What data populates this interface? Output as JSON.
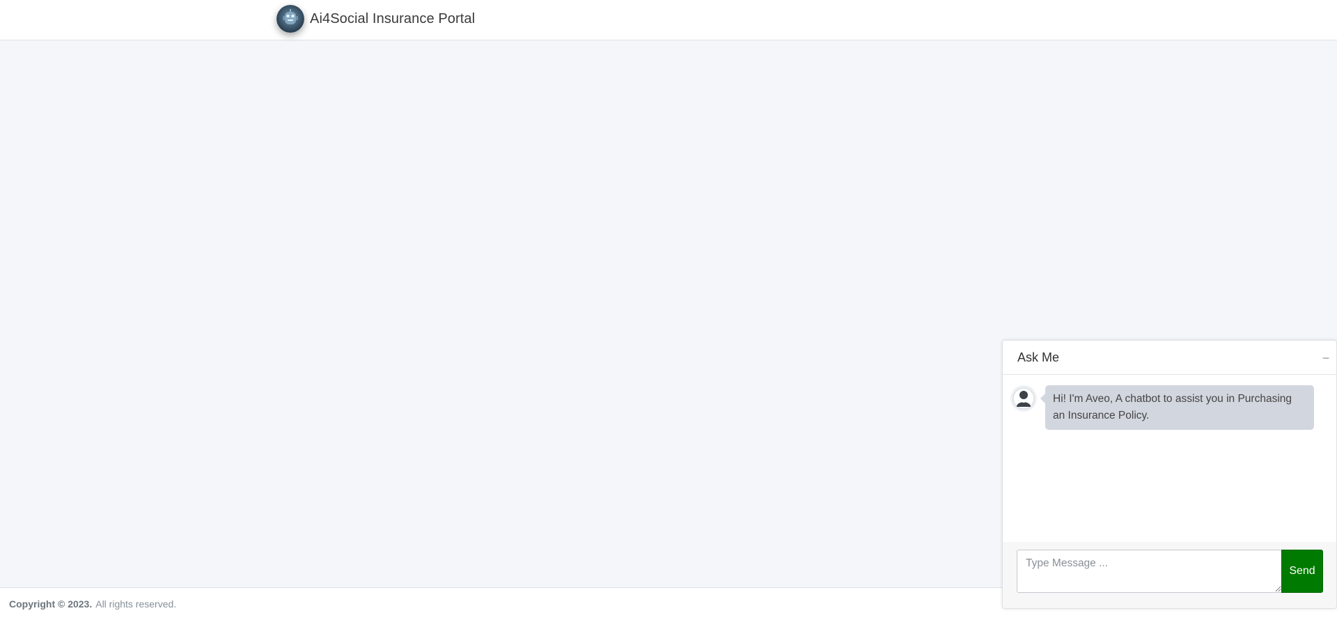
{
  "app": {
    "title": "Ai4Social Insurance Portal",
    "logo_icon": "robot-logo-icon"
  },
  "footer": {
    "copyright": "Copyright © 2023.",
    "rights": "All rights reserved."
  },
  "chat": {
    "title": "Ask Me",
    "minimize_label": "−",
    "messages": [
      {
        "sender_icon": "user-avatar-icon",
        "text": "Hi! I'm Aveo, A chatbot to assist you in Purchasing an Insurance Policy."
      }
    ],
    "input": {
      "placeholder": "Type Message ...",
      "value": ""
    },
    "send_label": "Send"
  },
  "colors": {
    "page_background": "#f4f6f9",
    "send_button": "#007a00",
    "bubble": "#d2d6de"
  }
}
